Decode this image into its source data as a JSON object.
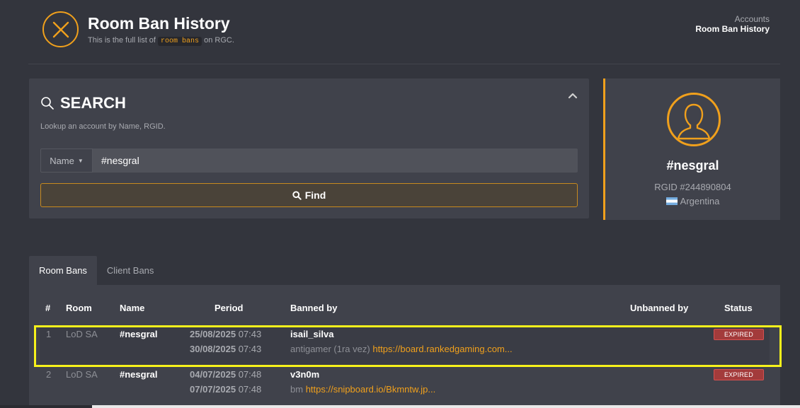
{
  "header": {
    "title": "Room Ban History",
    "subtitle_prefix": "This is the full list of",
    "subtitle_code": "room bans",
    "subtitle_suffix": "on RGC.",
    "breadcrumb": [
      "Accounts",
      "Room Ban History"
    ]
  },
  "search": {
    "title": "SEARCH",
    "description": "Lookup an account by Name, RGID.",
    "type_label": "Name",
    "input_value": "#nesgral",
    "find_label": "Find"
  },
  "profile": {
    "name": "#nesgral",
    "rgid": "RGID #244890804",
    "country": "Argentina"
  },
  "tabs": [
    {
      "label": "Room Bans",
      "active": true
    },
    {
      "label": "Client Bans",
      "active": false
    }
  ],
  "table": {
    "columns": [
      "#",
      "Room",
      "Name",
      "Period",
      "Banned by",
      "Unbanned by",
      "Status"
    ],
    "rows": [
      {
        "index": "1",
        "room": "LoD SA",
        "name": "#nesgral",
        "start_date": "25/08/2025",
        "start_time": "07:43",
        "end_date": "30/08/2025",
        "end_time": "07:43",
        "banned_by": "isail_silva",
        "reason": "antigamer (1ra vez)",
        "link": "https://board.rankedgaming.com...",
        "unbanned_by": "",
        "status": "EXPIRED"
      },
      {
        "index": "2",
        "room": "LoD SA",
        "name": "#nesgral",
        "start_date": "04/07/2025",
        "start_time": "07:48",
        "end_date": "07/07/2025",
        "end_time": "07:48",
        "banned_by": "v3n0m",
        "reason": "bm",
        "link": "https://snipboard.io/Bkmntw.jp...",
        "unbanned_by": "",
        "status": "EXPIRED"
      }
    ]
  },
  "colors": {
    "accent": "#f0a01c",
    "background": "#33353d",
    "panel": "#40424b",
    "expired": "#a33b3b",
    "highlight_box": "#f7f21b"
  },
  "icons": {
    "logo": "close-circle-icon",
    "search": "search-icon",
    "collapse": "chevron-up-icon",
    "avatar": "user-silhouette-icon",
    "flag": "argentina-flag-icon"
  }
}
